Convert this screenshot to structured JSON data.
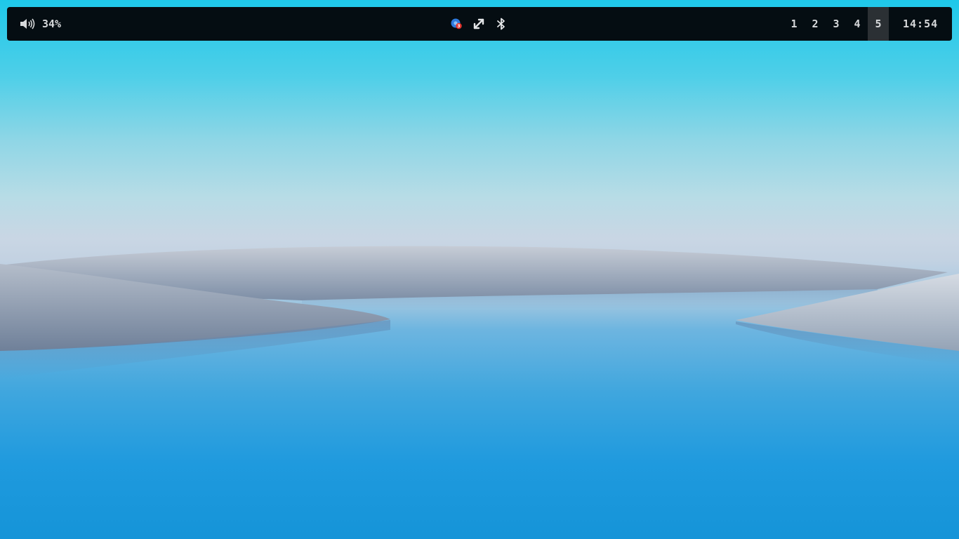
{
  "topbar": {
    "volume": {
      "icon": "speaker-icon",
      "level": "34%"
    },
    "tray": [
      {
        "name": "chromium-notification-icon",
        "badge": "3"
      },
      {
        "name": "network-transfer-icon"
      },
      {
        "name": "bluetooth-icon"
      }
    ],
    "workspaces": [
      {
        "label": "1",
        "active": false
      },
      {
        "label": "2",
        "active": false
      },
      {
        "label": "3",
        "active": false
      },
      {
        "label": "4",
        "active": false
      },
      {
        "label": "5",
        "active": true
      }
    ],
    "clock": "14:54"
  },
  "colors": {
    "bar_bg": "#050d12",
    "active_workspace_bg": "#2b3034",
    "bar_text": "#d6d8da",
    "sky_top": "#1ec8ea",
    "water_bottom": "#1594d8"
  }
}
